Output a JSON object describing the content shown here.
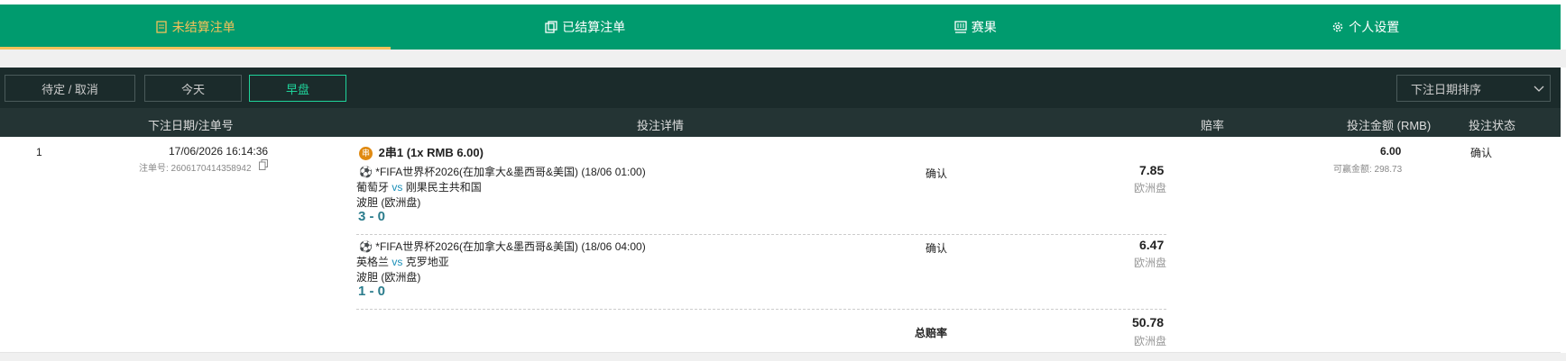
{
  "nav": {
    "tabs": [
      {
        "label": "未结算注单",
        "icon": "unsettled-slip-icon"
      },
      {
        "label": "已结算注单",
        "icon": "settled-slip-icon"
      },
      {
        "label": "赛果",
        "icon": "results-icon"
      },
      {
        "label": "个人设置",
        "icon": "gear-icon"
      }
    ],
    "active_tab": 0,
    "accent": "#f3c15a",
    "bg": "#009b6e"
  },
  "filters": {
    "pending": "待定 / 取消",
    "today": "今天",
    "early": "早盘",
    "active": "早盘",
    "sort_selected": "下注日期排序"
  },
  "table": {
    "headers": {
      "date": "下注日期/注单号",
      "details": "投注详情",
      "odds": "赔率",
      "amount": "投注金额 (RMB)",
      "status": "投注状态"
    },
    "rows": [
      {
        "index": "1",
        "datetime": "17/06/2026 16:14:36",
        "slip_no": "注单号: 2606170414358942",
        "bet_type": "2串1 (1x RMB 6.00)",
        "badge": "串",
        "legs": [
          {
            "match": "*FIFA世界杯2026(在加拿大&墨西哥&美国) (18/06 01:00)",
            "home": "葡萄牙",
            "vs": "vs",
            "away": "刚果民主共和国",
            "market": "波胆 (欧洲盘)",
            "selection": "3 - 0",
            "confirm": "确认",
            "odds": "7.85",
            "odds_type": "欧洲盘"
          },
          {
            "match": "*FIFA世界杯2026(在加拿大&墨西哥&美国) (18/06 04:00)",
            "home": "英格兰",
            "vs": "vs",
            "away": "克罗地亚",
            "market": "波胆 (欧洲盘)",
            "selection": "1 - 0",
            "confirm": "确认",
            "odds": "6.47",
            "odds_type": "欧洲盘"
          }
        ],
        "total_label": "总赔率",
        "total_odds": "50.78",
        "total_odds_type": "欧洲盘",
        "stake": "6.00",
        "potential_win": "可赢金额: 298.73",
        "status": "确认"
      }
    ]
  }
}
